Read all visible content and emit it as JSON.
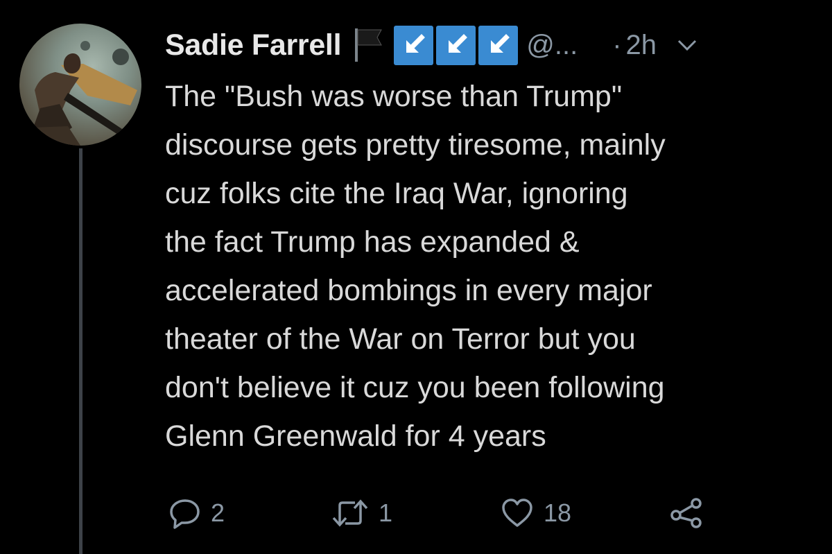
{
  "tweet": {
    "display_name": "Sadie Farrell",
    "handle": "@...",
    "separator": "·",
    "time": "2h",
    "text_lines": [
      "The \"Bush was worse than Trump\"",
      "discourse gets pretty tiresome, mainly",
      "cuz folks cite the Iraq War, ignoring",
      "the fact Trump has expanded &",
      "accelerated bombings in every major",
      "theater of the War on Terror but you",
      "don't believe it cuz you been following",
      "Glenn Greenwald for 4 years"
    ],
    "icons": {
      "flag": "black-flag-icon",
      "badges": [
        "arrow-down-left-icon",
        "arrow-down-left-icon",
        "arrow-down-left-icon"
      ],
      "menu": "chevron-down-icon"
    },
    "colors": {
      "background": "#000000",
      "text": "#d9d9d9",
      "muted": "#8b98a5",
      "badge": "#3a8bd2"
    }
  },
  "actions": {
    "reply_count": "2",
    "retweet_count": "1",
    "like_count": "18",
    "icons": [
      "reply-icon",
      "retweet-icon",
      "like-icon",
      "share-icon"
    ]
  }
}
